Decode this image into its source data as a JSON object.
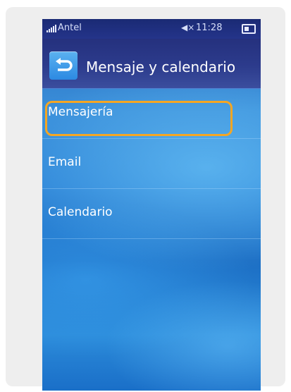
{
  "status": {
    "carrier": "Antel",
    "time": "11:28"
  },
  "header": {
    "title": "Mensaje y calendario"
  },
  "menu": {
    "items": [
      {
        "label": "Mensajería",
        "selected": true
      },
      {
        "label": "Email",
        "selected": false
      },
      {
        "label": "Calendario",
        "selected": false
      }
    ]
  },
  "colors": {
    "highlight": "#f5a623",
    "header": "#2c3b8c",
    "back_button": "#3a9be8"
  }
}
